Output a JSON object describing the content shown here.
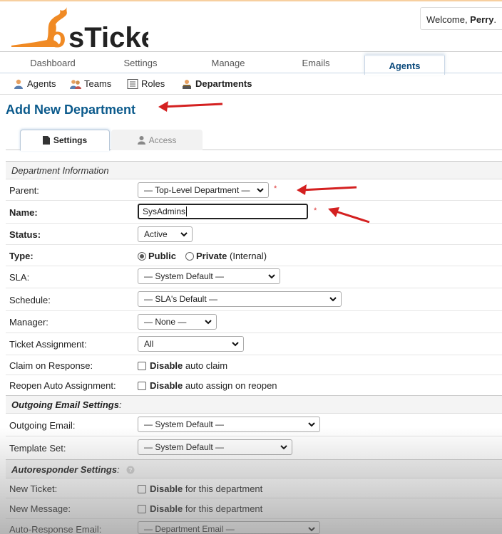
{
  "header": {
    "logo_text": "osTicket",
    "welcome_prefix": "Welcome, ",
    "welcome_user": "Perry",
    "welcome_suffix": "."
  },
  "main_nav": [
    "Dashboard",
    "Settings",
    "Manage",
    "Emails",
    "Agents"
  ],
  "main_nav_active": "Agents",
  "sub_nav": [
    {
      "label": "Agents",
      "icon": "agent-icon"
    },
    {
      "label": "Teams",
      "icon": "teams-icon"
    },
    {
      "label": "Roles",
      "icon": "roles-icon"
    },
    {
      "label": "Departments",
      "icon": "departments-icon"
    }
  ],
  "sub_nav_active": "Departments",
  "page_title": "Add New Department",
  "form_tabs": [
    {
      "label": "Settings",
      "icon": "file-icon",
      "active": true
    },
    {
      "label": "Access",
      "icon": "user-icon",
      "active": false
    }
  ],
  "sections": {
    "dept_info": "Department Information",
    "outgoing": "Outgoing Email Settings",
    "outgoing_suffix": ":",
    "autoresponder": "Autoresponder Settings",
    "autoresponder_suffix": ":"
  },
  "fields": {
    "parent": {
      "label": "Parent:",
      "value": "— Top-Level Department —",
      "required": "*"
    },
    "name": {
      "label": "Name:",
      "value": "SysAdmins",
      "required": "*"
    },
    "status": {
      "label": "Status:",
      "value": "Active"
    },
    "type": {
      "label": "Type:",
      "public": "Public",
      "private": "Private",
      "internal": "(Internal)",
      "selected": "Public"
    },
    "sla": {
      "label": "SLA:",
      "value": "— System Default —"
    },
    "schedule": {
      "label": "Schedule:",
      "value": "— SLA's Default —"
    },
    "manager": {
      "label": "Manager:",
      "value": "— None —"
    },
    "ticket_assignment": {
      "label": "Ticket Assignment:",
      "value": "All"
    },
    "claim_on_response": {
      "label": "Claim on Response:",
      "bold": "Disable",
      "rest": "auto claim"
    },
    "reopen_auto": {
      "label": "Reopen Auto Assignment:",
      "bold": "Disable",
      "rest": "auto assign on reopen"
    },
    "outgoing_email": {
      "label": "Outgoing Email:",
      "value": "— System Default —"
    },
    "template_set": {
      "label": "Template Set:",
      "value": "— System Default —"
    },
    "new_ticket": {
      "label": "New Ticket:",
      "bold": "Disable",
      "rest": "for this department"
    },
    "new_message": {
      "label": "New Message:",
      "bold": "Disable",
      "rest": "for this department"
    },
    "auto_response_email": {
      "label": "Auto-Response Email:",
      "value": "— Department Email —"
    }
  },
  "colors": {
    "logo_orange": "#f08a24",
    "title_blue": "#0b5a8c",
    "arrow_red": "#d42020"
  }
}
